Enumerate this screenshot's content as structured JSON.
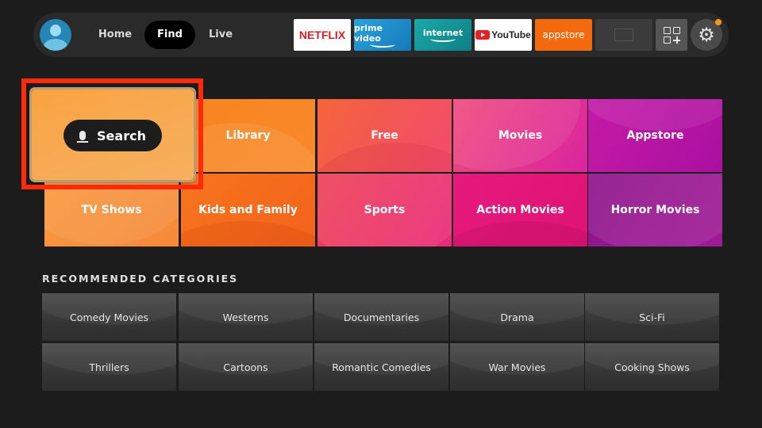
{
  "topbar": {
    "avatar_icon": "profile-avatar-icon",
    "nav": [
      {
        "label": "Home",
        "active": false
      },
      {
        "label": "Find",
        "active": true
      },
      {
        "label": "Live",
        "active": false
      }
    ],
    "apps": [
      {
        "name": "Netflix",
        "label": "NETFLIX"
      },
      {
        "name": "Prime Video",
        "label": "prime video"
      },
      {
        "name": "Internet",
        "label": "internet"
      },
      {
        "name": "YouTube",
        "label": "YouTube"
      },
      {
        "name": "Appstore",
        "label": "appstore"
      },
      {
        "name": "Placeholder app",
        "label": ""
      }
    ],
    "add_apps_icon": "apps-grid-plus-icon",
    "settings_icon": "gear-icon",
    "settings_notification": true,
    "colors": {
      "accent_notification": "#f29a12",
      "netflix_red": "#d81f26"
    }
  },
  "search_tile": {
    "label": "Search",
    "icon": "microphone-icon",
    "focused": true,
    "focus_color": "#ff2a0a"
  },
  "categories": [
    {
      "label": "Library",
      "color": "#f7841f"
    },
    {
      "label": "Free",
      "color": "#f2545b"
    },
    {
      "label": "Movies",
      "color": "#e8358f"
    },
    {
      "label": "Appstore",
      "color": "#b6149f"
    },
    {
      "label": "TV Shows",
      "color": "#f8933a"
    },
    {
      "label": "Kids and Family",
      "color": "#f56b1c"
    },
    {
      "label": "Sports",
      "color": "#ea3a62"
    },
    {
      "label": "Action Movies",
      "color": "#e11677"
    },
    {
      "label": "Horror Movies",
      "color": "#951690"
    }
  ],
  "recommended": {
    "title": "RECOMMENDED CATEGORIES",
    "items": [
      "Comedy Movies",
      "Westerns",
      "Documentaries",
      "Drama",
      "Sci-Fi",
      "Thrillers",
      "Cartoons",
      "Romantic Comedies",
      "War Movies",
      "Cooking Shows"
    ]
  }
}
